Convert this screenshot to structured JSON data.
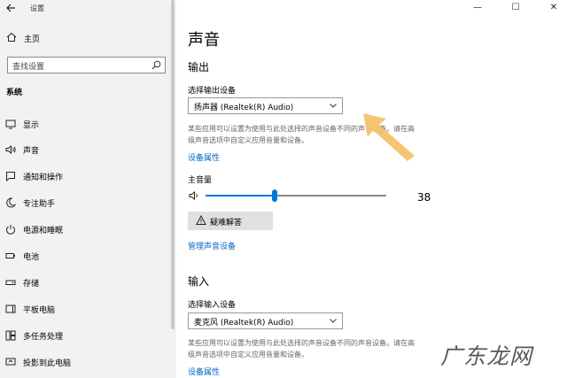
{
  "window": {
    "title": "设置",
    "controls": [
      "—",
      "☐",
      "✕"
    ]
  },
  "sidebar": {
    "home_label": "主页",
    "search_placeholder": "查找设置",
    "section_title": "系统",
    "items": [
      {
        "label": "显示",
        "icon": "monitor-icon"
      },
      {
        "label": "声音",
        "icon": "speaker-icon"
      },
      {
        "label": "通知和操作",
        "icon": "notification-icon"
      },
      {
        "label": "专注助手",
        "icon": "moon-icon"
      },
      {
        "label": "电源和睡眠",
        "icon": "power-icon"
      },
      {
        "label": "电池",
        "icon": "battery-icon"
      },
      {
        "label": "存储",
        "icon": "storage-icon"
      },
      {
        "label": "平板电脑",
        "icon": "tablet-icon"
      },
      {
        "label": "多任务处理",
        "icon": "multitask-icon"
      },
      {
        "label": "投影到此电脑",
        "icon": "projector-icon"
      }
    ]
  },
  "main": {
    "title": "声音",
    "output": {
      "heading": "输出",
      "device_label": "选择输出设备",
      "device_value": "扬声器 (Realtek(R) Audio)",
      "desc_line1": "某些应用可以设置为使用与此处选择的声音设备不同的声音设备。请在高",
      "desc_line2": "级声音选项中自定义应用音量和设备。",
      "properties_link": "设备属性",
      "master_volume_label": "主音量",
      "volume_value": "38",
      "volume_fraction": 0.38,
      "troubleshoot_label": "疑难解答",
      "manage_link": "管理声音设备"
    },
    "input": {
      "heading": "输入",
      "device_label": "选择输入设备",
      "device_value": "麦克风 (Realtek(R) Audio)",
      "desc_line1": "某些应用可以设置为使用与此处选择的声音设备不同的声音设备。请在高",
      "desc_line2": "级声音选项中自定义应用音量和设备。",
      "properties_link": "设备属性"
    }
  },
  "watermark": "广东龙网",
  "colors": {
    "accent": "#0078d7",
    "link": "#0067c0",
    "arrow": "#f5c26b",
    "sidebar_bg": "#f2f2f2"
  }
}
